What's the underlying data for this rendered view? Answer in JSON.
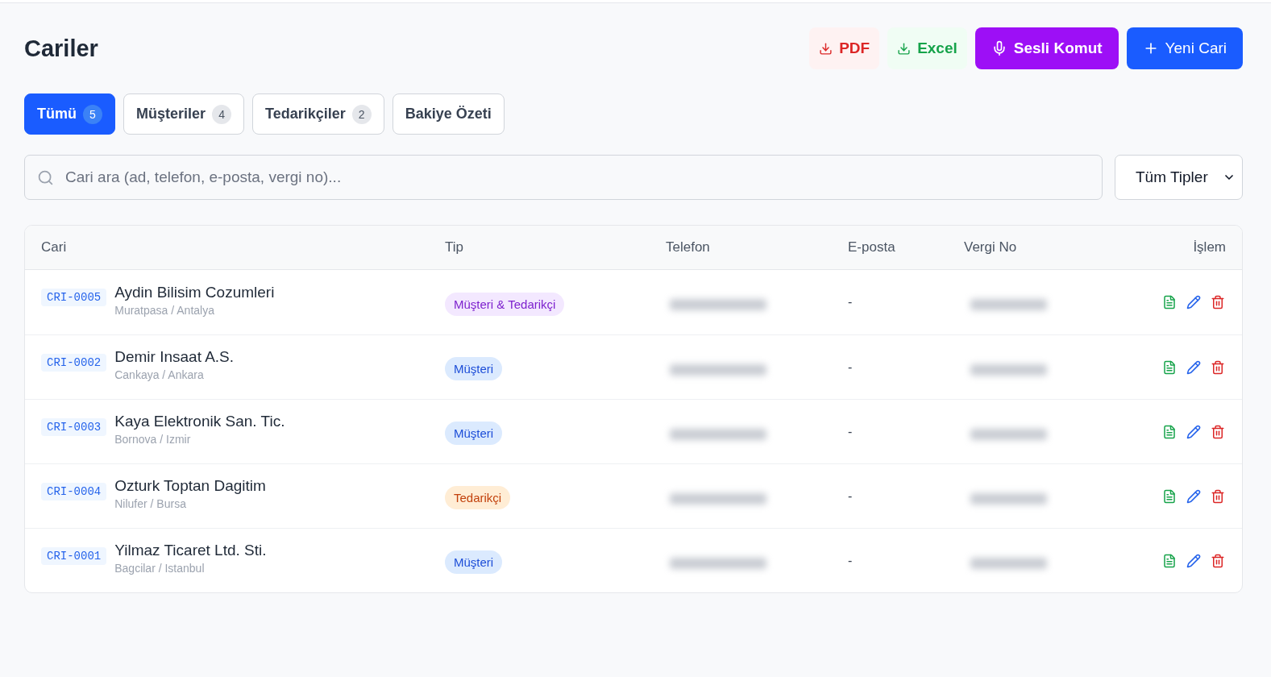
{
  "header": {
    "title": "Cariler",
    "buttons": [
      {
        "kind": "pdf",
        "label": "PDF"
      },
      {
        "kind": "excel",
        "label": "Excel"
      },
      {
        "kind": "voice",
        "label": "Sesli Komut"
      },
      {
        "kind": "new",
        "label": "Yeni Cari"
      }
    ]
  },
  "tabs": [
    {
      "label": "Tümü",
      "count": "5",
      "selected": true
    },
    {
      "label": "Müşteriler",
      "count": "4",
      "selected": false
    },
    {
      "label": "Tedarikçiler",
      "count": "2",
      "selected": false
    },
    {
      "label": "Bakiye Özeti",
      "selected": false
    }
  ],
  "search": {
    "placeholder": "Cari ara (ad, telefon, e-posta, vergi no)..."
  },
  "type_filter": {
    "value": "Tüm Tipler"
  },
  "table": {
    "columns": [
      "Cari",
      "Tip",
      "Telefon",
      "E-posta",
      "Vergi No",
      "İşlem"
    ],
    "rows": [
      {
        "code": "CRI-0005",
        "name": "Aydin Bilisim Cozumleri",
        "location": "Muratpasa / Antalya",
        "type": {
          "kind": "both",
          "label": "Müşteri & Tedarikçi"
        },
        "email": "-"
      },
      {
        "code": "CRI-0002",
        "name": "Demir Insaat A.S.",
        "location": "Cankaya / Ankara",
        "type": {
          "kind": "customer",
          "label": "Müşteri"
        },
        "email": "-"
      },
      {
        "code": "CRI-0003",
        "name": "Kaya Elektronik San. Tic.",
        "location": "Bornova / Izmir",
        "type": {
          "kind": "customer",
          "label": "Müşteri"
        },
        "email": "-"
      },
      {
        "code": "CRI-0004",
        "name": "Ozturk Toptan Dagitim",
        "location": "Nilufer / Bursa",
        "type": {
          "kind": "supplier",
          "label": "Tedarikçi"
        },
        "email": "-"
      },
      {
        "code": "CRI-0001",
        "name": "Yilmaz Ticaret Ltd. Sti.",
        "location": "Bagcilar / Istanbul",
        "type": {
          "kind": "customer",
          "label": "Müşteri"
        },
        "email": "-"
      }
    ]
  }
}
